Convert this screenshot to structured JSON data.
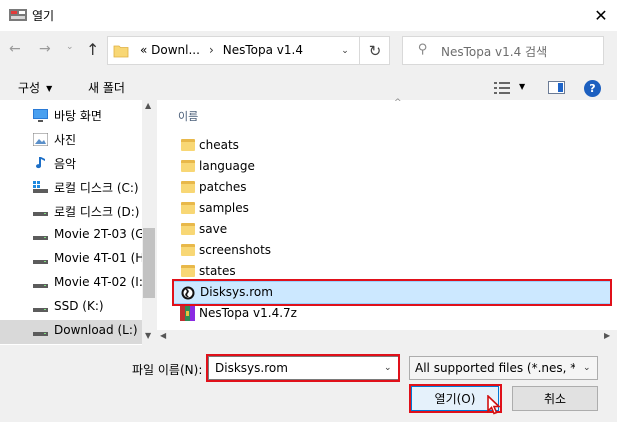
{
  "window": {
    "title": "열기",
    "close_glyph": "✕"
  },
  "nav": {
    "back_glyph": "←",
    "forward_glyph": "→",
    "recent_glyph": "⌄",
    "up_glyph": "↑",
    "breadcrumb": [
      "«  Downl...",
      "NesTopa v1.4"
    ],
    "breadcrumb_sep": "›",
    "address_dropdown_glyph": "⌄",
    "refresh_glyph": "↻",
    "search_placeholder": "NesTopa v1.4 검색"
  },
  "toolbar": {
    "organize_label": "구성",
    "organize_caret": "▼",
    "new_folder_label": "새 폴더",
    "view_caret": "▼",
    "help_label": "?"
  },
  "nav_pane": {
    "items": [
      {
        "label": "바탕 화면",
        "icon": "desktop-icon"
      },
      {
        "label": "사진",
        "icon": "pictures-icon"
      },
      {
        "label": "음악",
        "icon": "music-icon"
      },
      {
        "label": "로컬 디스크 (C:)",
        "icon": "system-drive-icon"
      },
      {
        "label": "로컬 디스크 (D:)",
        "icon": "drive-icon"
      },
      {
        "label": "Movie 2T-03 (G",
        "icon": "drive-icon"
      },
      {
        "label": "Movie 4T-01 (H",
        "icon": "drive-icon"
      },
      {
        "label": "Movie 4T-02 (I:)",
        "icon": "drive-icon"
      },
      {
        "label": "SSD (K:)",
        "icon": "drive-icon"
      },
      {
        "label": "Download (L:)",
        "icon": "drive-icon",
        "selected": true
      }
    ],
    "scroll_up_glyph": "▲",
    "scroll_down_glyph": "▼"
  },
  "file_list": {
    "column_name": "이름",
    "sort_glyph": "^",
    "items": [
      {
        "name": "cheats",
        "type": "folder"
      },
      {
        "name": "language",
        "type": "folder"
      },
      {
        "name": "patches",
        "type": "folder"
      },
      {
        "name": "samples",
        "type": "folder"
      },
      {
        "name": "save",
        "type": "folder"
      },
      {
        "name": "screenshots",
        "type": "folder"
      },
      {
        "name": "states",
        "type": "folder"
      },
      {
        "name": "Disksys.rom",
        "type": "rom",
        "selected": true
      },
      {
        "name": "NesTopa v1.4.7z",
        "type": "archive"
      }
    ],
    "hscroll_left_glyph": "◀",
    "hscroll_right_glyph": "▶"
  },
  "bottom": {
    "filename_label": "파일 이름(N):",
    "filename_value": "Disksys.rom",
    "filename_caret": "⌄",
    "filter_value": "All supported files (*.nes, *.rom",
    "filter_caret": "⌄",
    "open_label": "열기(O)",
    "cancel_label": "취소"
  },
  "colors": {
    "highlight_red": "#e0101a",
    "selection_blue": "#cce8ff",
    "accent_blue": "#0078d7"
  }
}
